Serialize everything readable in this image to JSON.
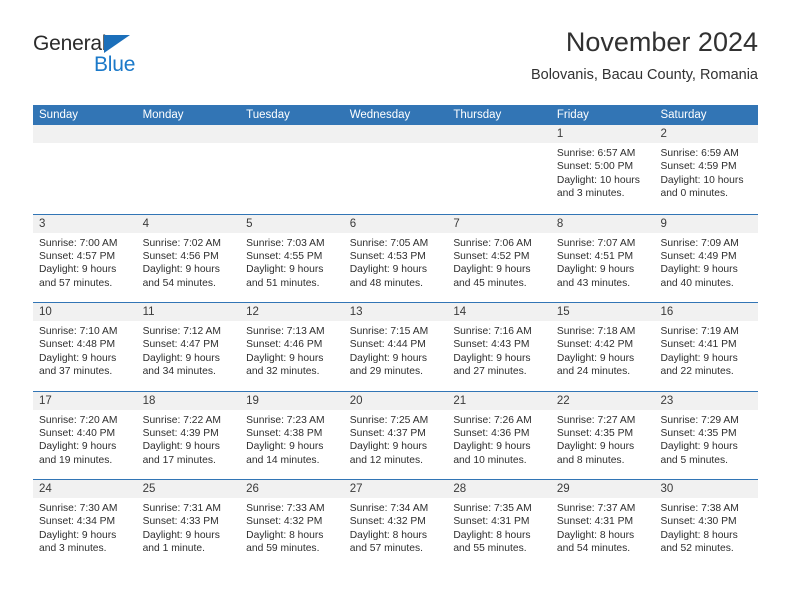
{
  "brand": {
    "name_top": "General",
    "name_bottom": "Blue",
    "accent_color": "#1b79c9",
    "triangle_color": "#1b6fba"
  },
  "header": {
    "title": "November 2024",
    "subtitle": "Bolovanis, Bacau County, Romania"
  },
  "calendar": {
    "header_bg": "#3275b5",
    "daynum_bg": "#f1f1f1",
    "weekdays": [
      "Sunday",
      "Monday",
      "Tuesday",
      "Wednesday",
      "Thursday",
      "Friday",
      "Saturday"
    ],
    "weeks": [
      [
        {
          "day": "",
          "empty": true
        },
        {
          "day": "",
          "empty": true
        },
        {
          "day": "",
          "empty": true
        },
        {
          "day": "",
          "empty": true
        },
        {
          "day": "",
          "empty": true
        },
        {
          "day": "1",
          "sunrise": "Sunrise: 6:57 AM",
          "sunset": "Sunset: 5:00 PM",
          "daylight": "Daylight: 10 hours and 3 minutes."
        },
        {
          "day": "2",
          "sunrise": "Sunrise: 6:59 AM",
          "sunset": "Sunset: 4:59 PM",
          "daylight": "Daylight: 10 hours and 0 minutes."
        }
      ],
      [
        {
          "day": "3",
          "sunrise": "Sunrise: 7:00 AM",
          "sunset": "Sunset: 4:57 PM",
          "daylight": "Daylight: 9 hours and 57 minutes."
        },
        {
          "day": "4",
          "sunrise": "Sunrise: 7:02 AM",
          "sunset": "Sunset: 4:56 PM",
          "daylight": "Daylight: 9 hours and 54 minutes."
        },
        {
          "day": "5",
          "sunrise": "Sunrise: 7:03 AM",
          "sunset": "Sunset: 4:55 PM",
          "daylight": "Daylight: 9 hours and 51 minutes."
        },
        {
          "day": "6",
          "sunrise": "Sunrise: 7:05 AM",
          "sunset": "Sunset: 4:53 PM",
          "daylight": "Daylight: 9 hours and 48 minutes."
        },
        {
          "day": "7",
          "sunrise": "Sunrise: 7:06 AM",
          "sunset": "Sunset: 4:52 PM",
          "daylight": "Daylight: 9 hours and 45 minutes."
        },
        {
          "day": "8",
          "sunrise": "Sunrise: 7:07 AM",
          "sunset": "Sunset: 4:51 PM",
          "daylight": "Daylight: 9 hours and 43 minutes."
        },
        {
          "day": "9",
          "sunrise": "Sunrise: 7:09 AM",
          "sunset": "Sunset: 4:49 PM",
          "daylight": "Daylight: 9 hours and 40 minutes."
        }
      ],
      [
        {
          "day": "10",
          "sunrise": "Sunrise: 7:10 AM",
          "sunset": "Sunset: 4:48 PM",
          "daylight": "Daylight: 9 hours and 37 minutes."
        },
        {
          "day": "11",
          "sunrise": "Sunrise: 7:12 AM",
          "sunset": "Sunset: 4:47 PM",
          "daylight": "Daylight: 9 hours and 34 minutes."
        },
        {
          "day": "12",
          "sunrise": "Sunrise: 7:13 AM",
          "sunset": "Sunset: 4:46 PM",
          "daylight": "Daylight: 9 hours and 32 minutes."
        },
        {
          "day": "13",
          "sunrise": "Sunrise: 7:15 AM",
          "sunset": "Sunset: 4:44 PM",
          "daylight": "Daylight: 9 hours and 29 minutes."
        },
        {
          "day": "14",
          "sunrise": "Sunrise: 7:16 AM",
          "sunset": "Sunset: 4:43 PM",
          "daylight": "Daylight: 9 hours and 27 minutes."
        },
        {
          "day": "15",
          "sunrise": "Sunrise: 7:18 AM",
          "sunset": "Sunset: 4:42 PM",
          "daylight": "Daylight: 9 hours and 24 minutes."
        },
        {
          "day": "16",
          "sunrise": "Sunrise: 7:19 AM",
          "sunset": "Sunset: 4:41 PM",
          "daylight": "Daylight: 9 hours and 22 minutes."
        }
      ],
      [
        {
          "day": "17",
          "sunrise": "Sunrise: 7:20 AM",
          "sunset": "Sunset: 4:40 PM",
          "daylight": "Daylight: 9 hours and 19 minutes."
        },
        {
          "day": "18",
          "sunrise": "Sunrise: 7:22 AM",
          "sunset": "Sunset: 4:39 PM",
          "daylight": "Daylight: 9 hours and 17 minutes."
        },
        {
          "day": "19",
          "sunrise": "Sunrise: 7:23 AM",
          "sunset": "Sunset: 4:38 PM",
          "daylight": "Daylight: 9 hours and 14 minutes."
        },
        {
          "day": "20",
          "sunrise": "Sunrise: 7:25 AM",
          "sunset": "Sunset: 4:37 PM",
          "daylight": "Daylight: 9 hours and 12 minutes."
        },
        {
          "day": "21",
          "sunrise": "Sunrise: 7:26 AM",
          "sunset": "Sunset: 4:36 PM",
          "daylight": "Daylight: 9 hours and 10 minutes."
        },
        {
          "day": "22",
          "sunrise": "Sunrise: 7:27 AM",
          "sunset": "Sunset: 4:35 PM",
          "daylight": "Daylight: 9 hours and 8 minutes."
        },
        {
          "day": "23",
          "sunrise": "Sunrise: 7:29 AM",
          "sunset": "Sunset: 4:35 PM",
          "daylight": "Daylight: 9 hours and 5 minutes."
        }
      ],
      [
        {
          "day": "24",
          "sunrise": "Sunrise: 7:30 AM",
          "sunset": "Sunset: 4:34 PM",
          "daylight": "Daylight: 9 hours and 3 minutes."
        },
        {
          "day": "25",
          "sunrise": "Sunrise: 7:31 AM",
          "sunset": "Sunset: 4:33 PM",
          "daylight": "Daylight: 9 hours and 1 minute."
        },
        {
          "day": "26",
          "sunrise": "Sunrise: 7:33 AM",
          "sunset": "Sunset: 4:32 PM",
          "daylight": "Daylight: 8 hours and 59 minutes."
        },
        {
          "day": "27",
          "sunrise": "Sunrise: 7:34 AM",
          "sunset": "Sunset: 4:32 PM",
          "daylight": "Daylight: 8 hours and 57 minutes."
        },
        {
          "day": "28",
          "sunrise": "Sunrise: 7:35 AM",
          "sunset": "Sunset: 4:31 PM",
          "daylight": "Daylight: 8 hours and 55 minutes."
        },
        {
          "day": "29",
          "sunrise": "Sunrise: 7:37 AM",
          "sunset": "Sunset: 4:31 PM",
          "daylight": "Daylight: 8 hours and 54 minutes."
        },
        {
          "day": "30",
          "sunrise": "Sunrise: 7:38 AM",
          "sunset": "Sunset: 4:30 PM",
          "daylight": "Daylight: 8 hours and 52 minutes."
        }
      ]
    ]
  }
}
